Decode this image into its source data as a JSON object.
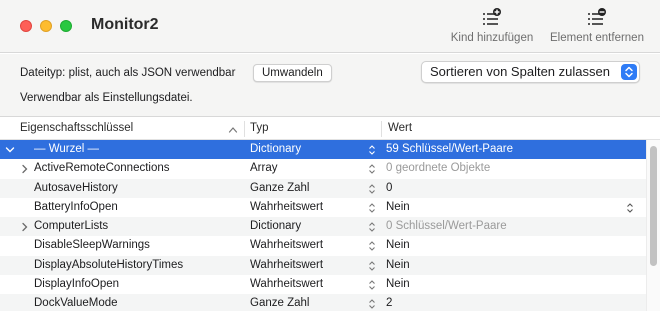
{
  "window": {
    "title": "Monitor2"
  },
  "toolbar": {
    "add_label": "Kind hinzufügen",
    "remove_label": "Element entfernen"
  },
  "info": {
    "filetype_text": "Dateityp: plist, auch als JSON verwendbar",
    "convert_label": "Umwandeln",
    "sort_selected": "Sortieren von Spalten zulassen",
    "usable_text": "Verwendbar als Einstellungsdatei."
  },
  "table": {
    "headers": {
      "key": "Eigenschaftsschlüssel",
      "type": "Typ",
      "value": "Wert"
    },
    "rows": [
      {
        "key": "— Wurzel —",
        "type": "Dictionary",
        "value": "59 Schlüssel/Wert-Paare",
        "disclosure": "expanded",
        "value_style": "normal",
        "value_popup": false
      },
      {
        "key": "ActiveRemoteConnections",
        "type": "Array",
        "value": "0 geordnete Objekte",
        "disclosure": "collapsed",
        "value_style": "muted",
        "value_popup": false
      },
      {
        "key": "AutosaveHistory",
        "type": "Ganze Zahl",
        "value": "0",
        "disclosure": "none",
        "value_style": "normal",
        "value_popup": false
      },
      {
        "key": "BatteryInfoOpen",
        "type": "Wahrheitswert",
        "value": "Nein",
        "disclosure": "none",
        "value_style": "normal",
        "value_popup": true
      },
      {
        "key": "ComputerLists",
        "type": "Dictionary",
        "value": "0 Schlüssel/Wert-Paare",
        "disclosure": "collapsed",
        "value_style": "muted",
        "value_popup": false
      },
      {
        "key": "DisableSleepWarnings",
        "type": "Wahrheitswert",
        "value": "Nein",
        "disclosure": "none",
        "value_style": "normal",
        "value_popup": true
      },
      {
        "key": "DisplayAbsoluteHistoryTimes",
        "type": "Wahrheitswert",
        "value": "Nein",
        "disclosure": "none",
        "value_style": "normal",
        "value_popup": true
      },
      {
        "key": "DisplayInfoOpen",
        "type": "Wahrheitswert",
        "value": "Nein",
        "disclosure": "none",
        "value_style": "normal",
        "value_popup": true
      },
      {
        "key": "DockValueMode",
        "type": "Ganze Zahl",
        "value": "2",
        "disclosure": "none",
        "value_style": "normal",
        "value_popup": false
      }
    ]
  },
  "colors": {
    "selection": "#2f6fde",
    "accent": "#2f7cf6",
    "traffic_red": "#fe5f57",
    "traffic_yellow": "#febc2e",
    "traffic_green": "#28c840"
  }
}
